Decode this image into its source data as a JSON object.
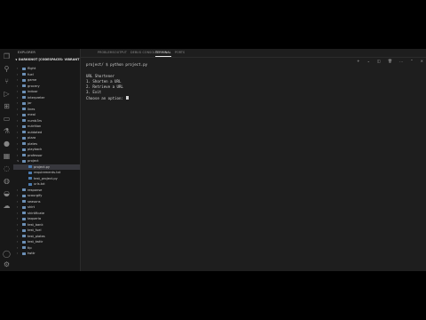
{
  "sidebar": {
    "title": "EXPLORER",
    "workspace": "∨ DARKKNOT [CODESPACES: VIBRANT M...",
    "items": [
      {
        "label": "flight",
        "type": "folder",
        "depth": 0,
        "open": false
      },
      {
        "label": "fuel",
        "type": "folder",
        "depth": 0,
        "open": false
      },
      {
        "label": "game",
        "type": "folder",
        "depth": 0,
        "open": false
      },
      {
        "label": "grocery",
        "type": "folder",
        "depth": 0,
        "open": false
      },
      {
        "label": "indoor",
        "type": "folder",
        "depth": 0,
        "open": false
      },
      {
        "label": "interpreter",
        "type": "folder",
        "depth": 0,
        "open": false
      },
      {
        "label": "jar",
        "type": "folder",
        "depth": 0,
        "open": false
      },
      {
        "label": "lines",
        "type": "folder",
        "depth": 0,
        "open": false
      },
      {
        "label": "meal",
        "type": "folder",
        "depth": 0,
        "open": false
      },
      {
        "label": "numb3rs",
        "type": "folder",
        "depth": 0,
        "open": false
      },
      {
        "label": "nutrition",
        "type": "folder",
        "depth": 0,
        "open": false
      },
      {
        "label": "outdated",
        "type": "folder",
        "depth": 0,
        "open": false
      },
      {
        "label": "pizza",
        "type": "folder",
        "depth": 0,
        "open": false
      },
      {
        "label": "plates",
        "type": "folder",
        "depth": 0,
        "open": false
      },
      {
        "label": "playback",
        "type": "folder",
        "depth": 0,
        "open": false
      },
      {
        "label": "professor",
        "type": "folder",
        "depth": 0,
        "open": false
      },
      {
        "label": "project",
        "type": "folder",
        "depth": 0,
        "open": true
      },
      {
        "label": "project.py",
        "type": "file",
        "depth": 1,
        "selected": true
      },
      {
        "label": "requirements.txt",
        "type": "file",
        "depth": 1
      },
      {
        "label": "test_project.py",
        "type": "file",
        "depth": 1
      },
      {
        "label": "urls.txt",
        "type": "file",
        "depth": 1
      },
      {
        "label": "response",
        "type": "folder",
        "depth": 0,
        "open": false
      },
      {
        "label": "scourgify",
        "type": "folder",
        "depth": 0,
        "open": false
      },
      {
        "label": "seasons",
        "type": "folder",
        "depth": 0,
        "open": false
      },
      {
        "label": "shirt",
        "type": "folder",
        "depth": 0,
        "open": false
      },
      {
        "label": "shirtificate",
        "type": "folder",
        "depth": 0,
        "open": false
      },
      {
        "label": "taqueria",
        "type": "folder",
        "depth": 0,
        "open": false
      },
      {
        "label": "test_bank",
        "type": "folder",
        "depth": 0,
        "open": false
      },
      {
        "label": "test_fuel",
        "type": "folder",
        "depth": 0,
        "open": false
      },
      {
        "label": "test_plates",
        "type": "folder",
        "depth": 0,
        "open": false
      },
      {
        "label": "test_twttr",
        "type": "folder",
        "depth": 0,
        "open": false
      },
      {
        "label": "tip",
        "type": "folder",
        "depth": 0,
        "open": false
      },
      {
        "label": "twttr",
        "type": "folder",
        "depth": 0,
        "open": false
      }
    ]
  },
  "panel": {
    "tabs": [
      {
        "label": "PROBLEMS",
        "active": false
      },
      {
        "label": "OUTPUT",
        "active": false
      },
      {
        "label": "DEBUG CONSOLE",
        "active": false
      },
      {
        "label": "TERMINAL",
        "active": true
      },
      {
        "label": "PORTS",
        "active": false
      }
    ],
    "actions": [
      "plus-icon",
      "chevron-down-icon",
      "split-icon",
      "trash-icon",
      "ellipsis-icon",
      "chevron-up-icon",
      "close-icon"
    ]
  },
  "terminal": {
    "lines": [
      "project/ $ python project.py",
      "",
      "URL Shortener",
      "1. Shorten a URL",
      "2. Retrieve a URL",
      "3. Exit",
      "Choose an option: "
    ]
  },
  "colors": {
    "accent": "#e7e7e7",
    "background": "#1e1e1e",
    "sidebar": "#181818",
    "selection": "#37373d"
  }
}
